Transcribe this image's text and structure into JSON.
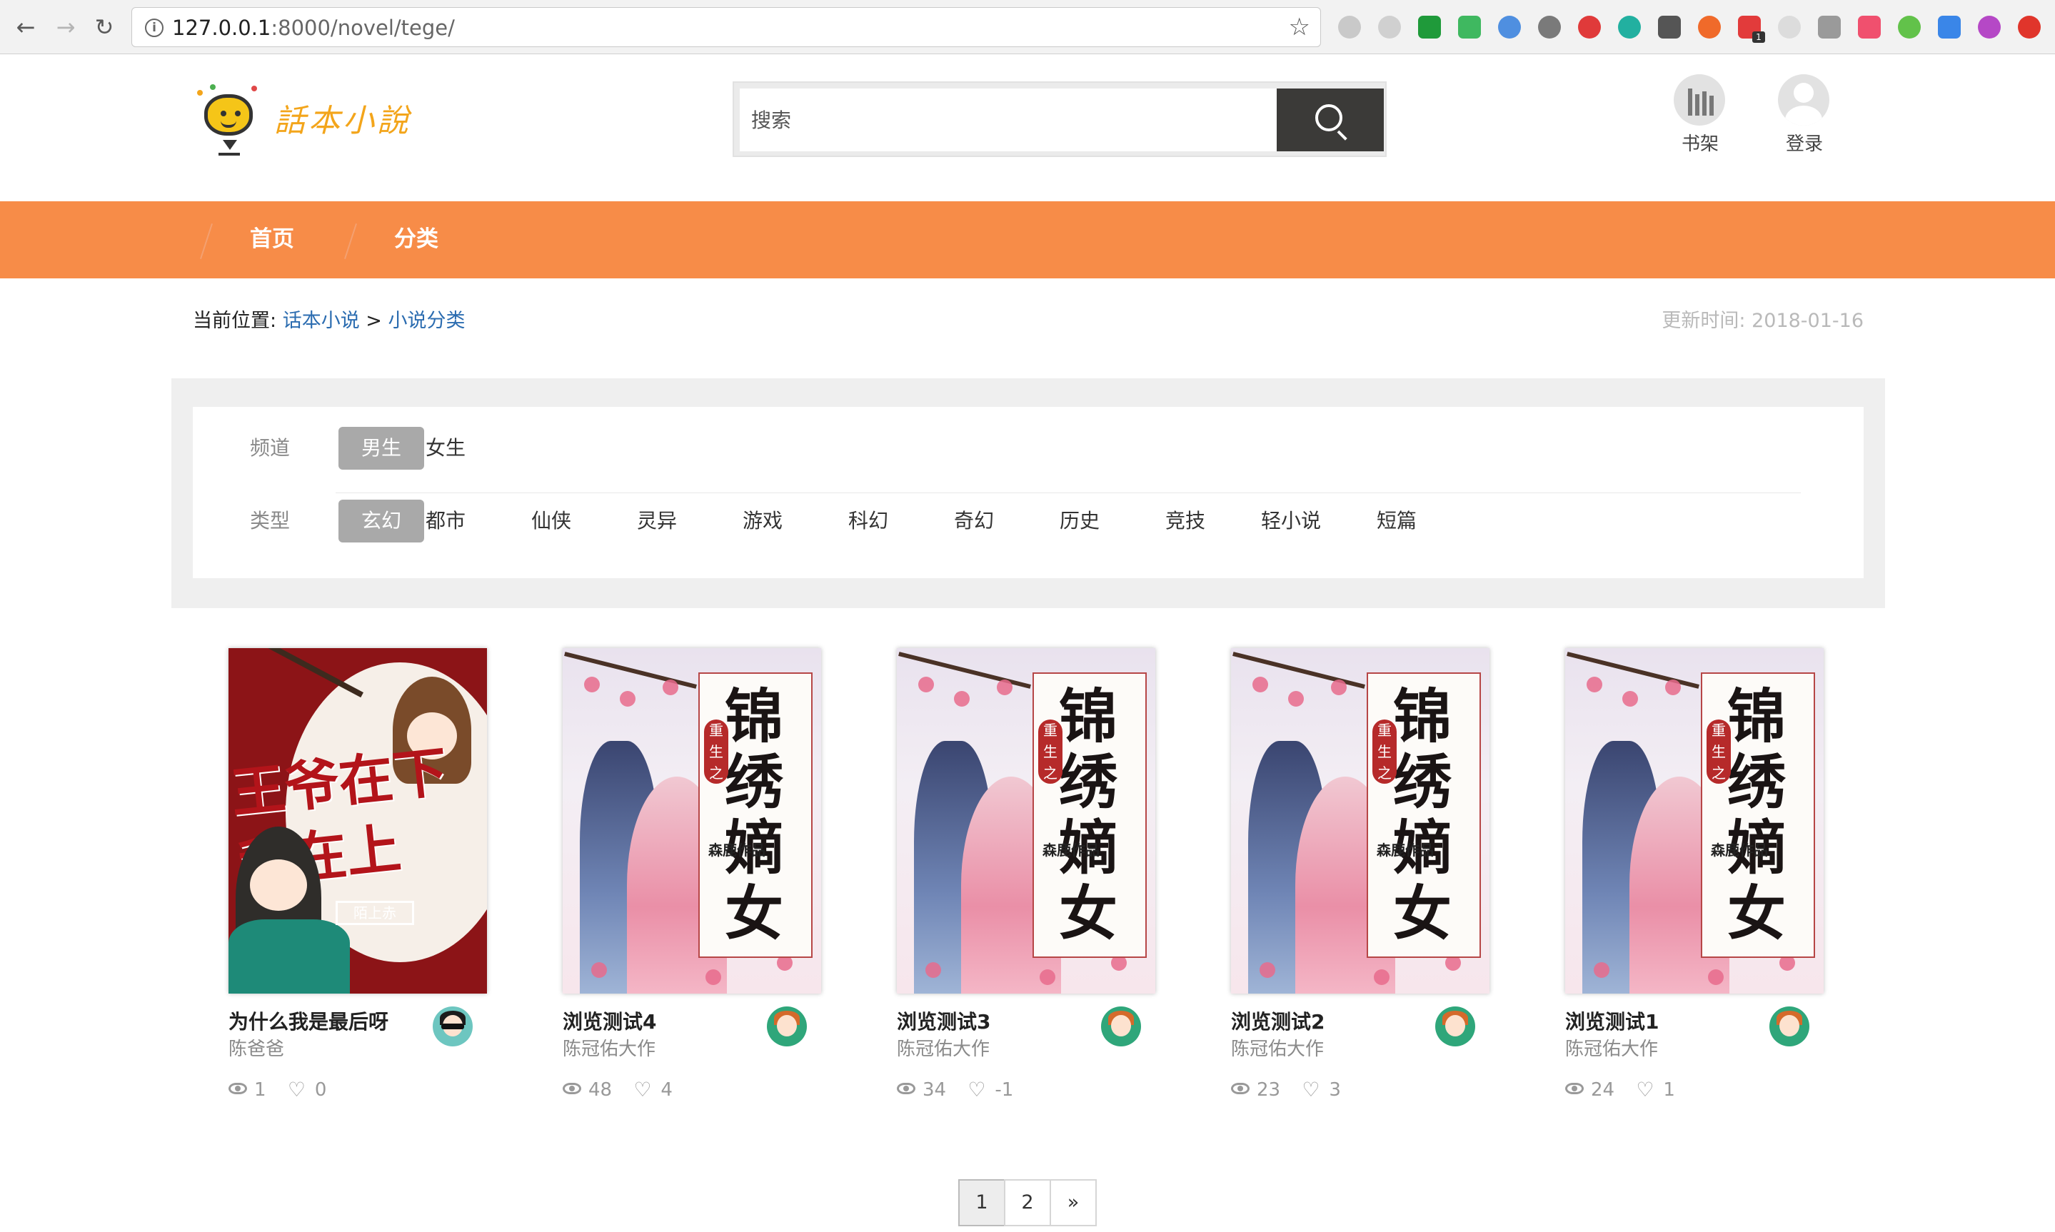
{
  "browser": {
    "url_host": "127.0.0.1",
    "url_rest": ":8000/novel/tege/"
  },
  "header": {
    "site_name": "話本小說",
    "search_placeholder": "搜索",
    "shelf_label": "书架",
    "login_label": "登录"
  },
  "nav": {
    "items": [
      "首页",
      "分类"
    ]
  },
  "breadcrumb": {
    "prefix": "当前位置:",
    "home": "话本小说",
    "separator": ">",
    "current": "小说分类"
  },
  "updated": "更新时间: 2018-01-16",
  "filters": {
    "channel_label": "频道",
    "channels": [
      "男生",
      "女生"
    ],
    "channel_active": "男生",
    "type_label": "类型",
    "types": [
      "玄幻",
      "都市",
      "仙侠",
      "灵异",
      "游戏",
      "科幻",
      "奇幻",
      "历史",
      "竞技",
      "轻小说",
      "短篇"
    ],
    "type_active": "玄幻"
  },
  "books": [
    {
      "title": "为什么我是最后呀",
      "author": "陈爸爸",
      "views": "1",
      "likes": "0",
      "cover_text": "王爷在下我在上",
      "cover_seal": "陌上赤"
    },
    {
      "title": "浏览测试4",
      "author": "陈冠佑大作",
      "views": "48",
      "likes": "4",
      "cover_text": "锦绣嫡女",
      "cover_seal": "森鹿作品",
      "cover_sub": "重生之"
    },
    {
      "title": "浏览测试3",
      "author": "陈冠佑大作",
      "views": "34",
      "likes": "-1",
      "cover_text": "锦绣嫡女",
      "cover_seal": "森鹿作品",
      "cover_sub": "重生之"
    },
    {
      "title": "浏览测试2",
      "author": "陈冠佑大作",
      "views": "23",
      "likes": "3",
      "cover_text": "锦绣嫡女",
      "cover_seal": "森鹿作品",
      "cover_sub": "重生之"
    },
    {
      "title": "浏览测试1",
      "author": "陈冠佑大作",
      "views": "24",
      "likes": "1",
      "cover_text": "锦绣嫡女",
      "cover_seal": "森鹿作品",
      "cover_sub": "重生之"
    }
  ],
  "pagination": {
    "pages": [
      "1",
      "2"
    ],
    "next": "»",
    "current": "1"
  },
  "colors": {
    "nav_bg": "#f78c48",
    "link": "#2b6cb0",
    "search_button": "#3b3a38"
  },
  "icons": [
    "back-icon",
    "forward-icon",
    "reload-icon",
    "info-icon",
    "bookmark-star-icon",
    "search-icon",
    "bookshelf-icon",
    "user-avatar-icon",
    "eye-icon",
    "heart-icon"
  ]
}
